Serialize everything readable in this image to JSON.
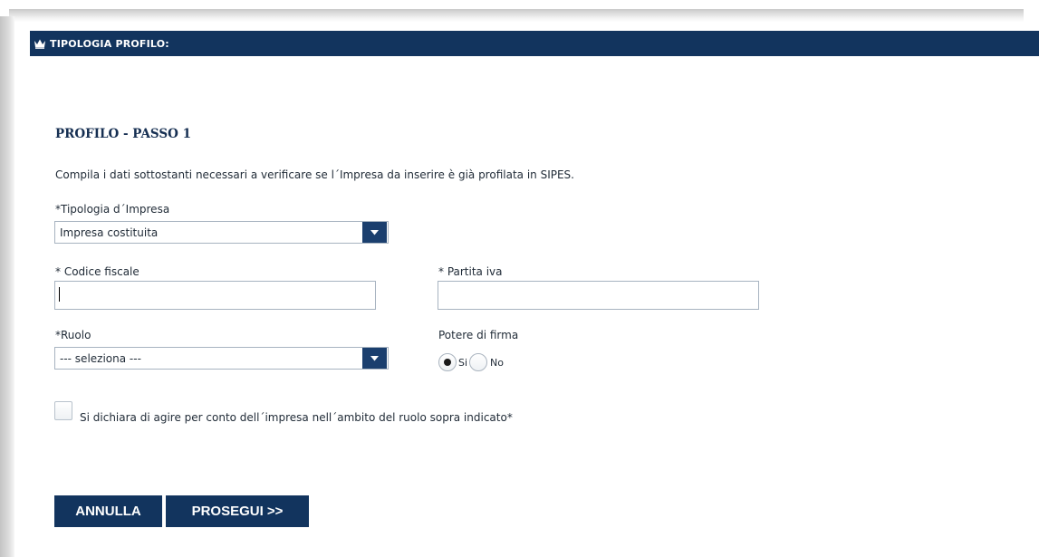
{
  "header": {
    "title": "TIPOLOGIA PROFILO:",
    "icon": "crown-icon"
  },
  "step": {
    "title": "PROFILO - PASSO 1",
    "intro": "Compila i dati sottostanti necessari a verificare se l´Impresa da inserire è già profilata in SIPES."
  },
  "form": {
    "tipologia": {
      "label": "*Tipologia d´Impresa",
      "value": "Impresa costituita"
    },
    "codice_fiscale": {
      "label": "* Codice fiscale",
      "value": ""
    },
    "partita_iva": {
      "label": "* Partita iva",
      "value": ""
    },
    "ruolo": {
      "label": "*Ruolo",
      "value": "--- seleziona ---"
    },
    "potere_firma": {
      "label": "Potere di firma",
      "options": [
        "Si",
        "No"
      ],
      "selected": "Si"
    },
    "dichiarazione": {
      "label": "Si dichiara di agire per conto dell´impresa nell´ambito del ruolo sopra indicato*",
      "checked": false
    }
  },
  "buttons": {
    "annulla": "ANNULLA",
    "prosegui": "PROSEGUI >>"
  },
  "colors": {
    "primary": "#12345e",
    "title": "#162f52"
  }
}
